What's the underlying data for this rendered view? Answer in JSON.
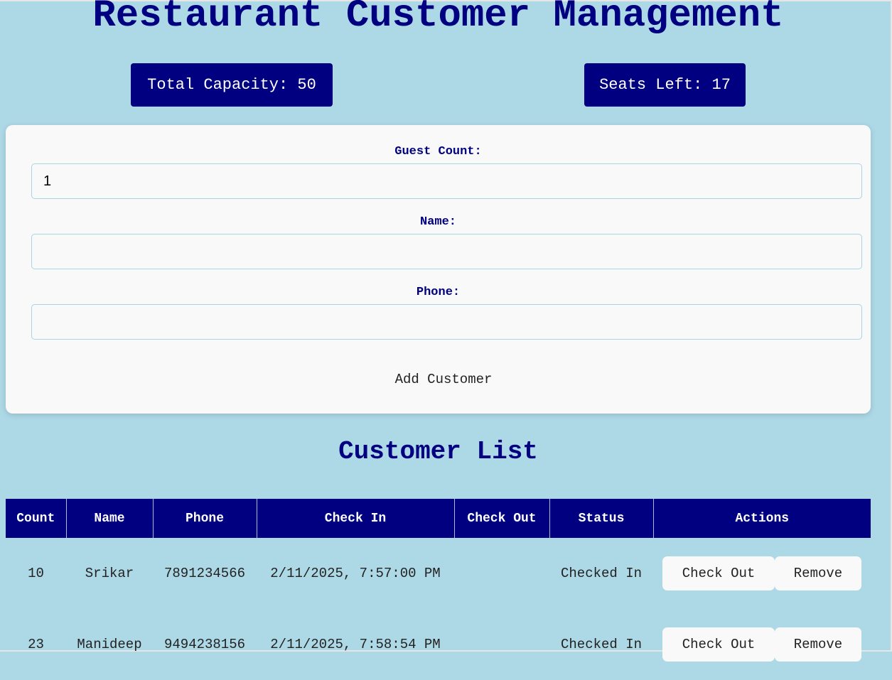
{
  "header": {
    "title": "Restaurant Customer Management"
  },
  "stats": {
    "total_capacity": "Total Capacity: 50",
    "seats_left": "Seats Left: 17"
  },
  "form": {
    "guest_count_label": "Guest Count:",
    "guest_count_value": "1",
    "name_label": "Name:",
    "name_value": "",
    "phone_label": "Phone:",
    "phone_value": "",
    "add_button_label": "Add Customer"
  },
  "customer_list": {
    "title": "Customer List",
    "columns": [
      "Count",
      "Name",
      "Phone",
      "Check In",
      "Check Out",
      "Status",
      "Actions"
    ],
    "rows": [
      {
        "count": "10",
        "name": "Srikar",
        "phone": "7891234566",
        "check_in": "2/11/2025, 7:57:00 PM",
        "check_out": "",
        "status": "Checked In",
        "checkout_label": "Check Out",
        "remove_label": "Remove"
      },
      {
        "count": "23",
        "name": "Manideep",
        "phone": "9494238156",
        "check_in": "2/11/2025, 7:58:54 PM",
        "check_out": "",
        "status": "Checked In",
        "checkout_label": "Check Out",
        "remove_label": "Remove"
      }
    ]
  },
  "colors": {
    "background": "#add8e6",
    "accent": "#000080",
    "card": "#f9f9f9"
  }
}
